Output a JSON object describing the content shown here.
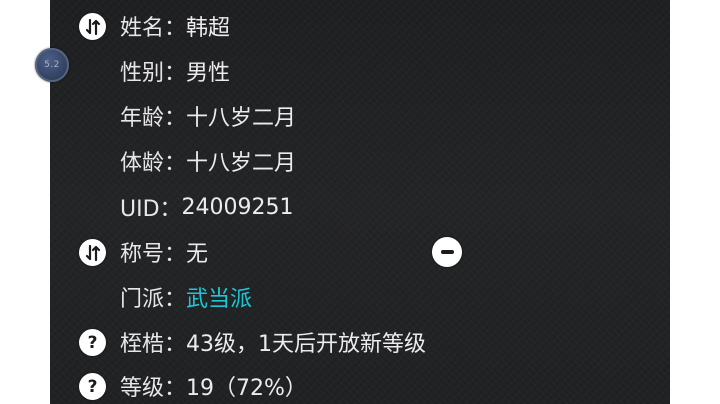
{
  "badge": {
    "text": "5.2"
  },
  "rows": [
    {
      "label": "姓名：",
      "value": "韩超"
    },
    {
      "label": "性别：",
      "value": "男性"
    },
    {
      "label": "年龄：",
      "value": "十八岁二月"
    },
    {
      "label": "体龄：",
      "value": "十八岁二月"
    },
    {
      "label": "UID：",
      "value": "24009251"
    },
    {
      "label": "称号：",
      "value": "无"
    },
    {
      "label": "门派：",
      "value": "武当派"
    },
    {
      "label": "桎梏：",
      "value": "43级，1天后开放新等级"
    },
    {
      "label": "等级：",
      "value": "19（72%）"
    }
  ],
  "icons": {
    "name": "swap-icon",
    "title": "swap-icon",
    "shackle": "help-icon",
    "level": "help-icon",
    "remove": "minus-icon"
  },
  "colors": {
    "panel": "#1f2022",
    "text": "#e7e7e7",
    "sect_highlight": "#21c6d6"
  }
}
